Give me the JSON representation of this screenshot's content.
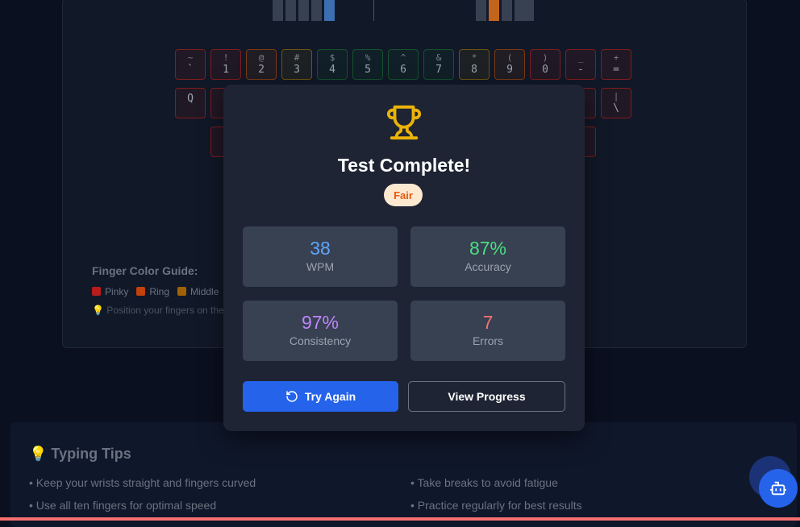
{
  "keyboard": {
    "row1": [
      {
        "shift": "~",
        "main": "`",
        "color": "red"
      },
      {
        "shift": "!",
        "main": "1",
        "color": "red"
      },
      {
        "shift": "@",
        "main": "2",
        "color": "orange"
      },
      {
        "shift": "#",
        "main": "3",
        "color": "yellow"
      },
      {
        "shift": "$",
        "main": "4",
        "color": "green"
      },
      {
        "shift": "%",
        "main": "5",
        "color": "green"
      },
      {
        "shift": "^",
        "main": "6",
        "color": "green"
      },
      {
        "shift": "&",
        "main": "7",
        "color": "green"
      },
      {
        "shift": "*",
        "main": "8",
        "color": "yellow"
      },
      {
        "shift": "(",
        "main": "9",
        "color": "orange"
      },
      {
        "shift": ")",
        "main": "0",
        "color": "red"
      },
      {
        "shift": "_",
        "main": "-",
        "color": "red"
      },
      {
        "shift": "+",
        "main": "=",
        "color": "red"
      }
    ],
    "row2_left": {
      "main": "Q",
      "color": "red"
    },
    "row2_right": {
      "shift": "|",
      "main": "\\",
      "color": "red"
    }
  },
  "guide": {
    "title": "Finger Color Guide:",
    "items": [
      {
        "label": "Pinky",
        "color": "#b91c1c"
      },
      {
        "label": "Ring",
        "color": "#c2410c"
      },
      {
        "label": "Middle",
        "color": "#a16207"
      }
    ],
    "tip": "💡 Position your fingers on the"
  },
  "modal": {
    "title": "Test Complete!",
    "rating": "Fair",
    "stats": [
      {
        "value": "38",
        "label": "WPM",
        "color": "#60a5fa"
      },
      {
        "value": "87%",
        "label": "Accuracy",
        "color": "#4ade80"
      },
      {
        "value": "97%",
        "label": "Consistency",
        "color": "#c084fc"
      },
      {
        "value": "7",
        "label": "Errors",
        "color": "#f87171"
      }
    ],
    "try_again": "Try Again",
    "view_progress": "View Progress"
  },
  "tips": {
    "title": "💡 Typing Tips",
    "items": [
      "• Keep your wrists straight and fingers curved",
      "• Take breaks to avoid fatigue",
      "• Use all ten fingers for optimal speed",
      "• Practice regularly for best results"
    ]
  },
  "colors": {
    "accent": "#2563eb",
    "trophy": "#eab308",
    "bar_active_blue": "#3b6fb0",
    "bar_active_orange": "#c2641c"
  }
}
